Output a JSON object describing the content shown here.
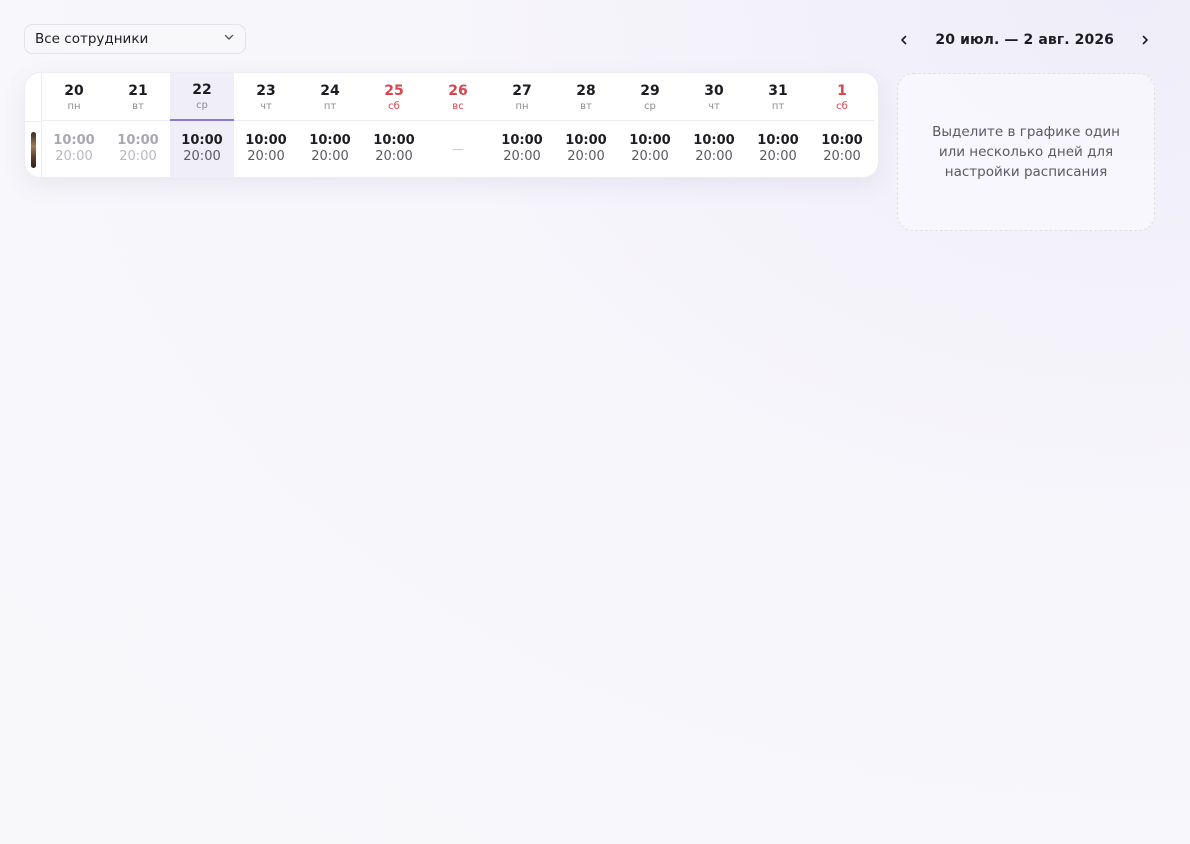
{
  "filter": {
    "label": "Все сотрудники"
  },
  "date_nav": {
    "range": "20 июл. — 2 авг. 2026"
  },
  "days": [
    {
      "num": "20",
      "wd": "пн",
      "start": "10:00",
      "end": "20:00",
      "state": "past"
    },
    {
      "num": "21",
      "wd": "вт",
      "start": "10:00",
      "end": "20:00",
      "state": "past"
    },
    {
      "num": "22",
      "wd": "ср",
      "start": "10:00",
      "end": "20:00",
      "state": "today"
    },
    {
      "num": "23",
      "wd": "чт",
      "start": "10:00",
      "end": "20:00",
      "state": "normal"
    },
    {
      "num": "24",
      "wd": "пт",
      "start": "10:00",
      "end": "20:00",
      "state": "normal"
    },
    {
      "num": "25",
      "wd": "сб",
      "start": "10:00",
      "end": "20:00",
      "state": "weekend"
    },
    {
      "num": "26",
      "wd": "вс",
      "start": "",
      "end": "",
      "off": "—",
      "state": "weekend"
    },
    {
      "num": "27",
      "wd": "пн",
      "start": "10:00",
      "end": "20:00",
      "state": "normal"
    },
    {
      "num": "28",
      "wd": "вт",
      "start": "10:00",
      "end": "20:00",
      "state": "normal"
    },
    {
      "num": "29",
      "wd": "ср",
      "start": "10:00",
      "end": "20:00",
      "state": "normal"
    },
    {
      "num": "30",
      "wd": "чт",
      "start": "10:00",
      "end": "20:00",
      "state": "normal"
    },
    {
      "num": "31",
      "wd": "пт",
      "start": "10:00",
      "end": "20:00",
      "state": "normal"
    },
    {
      "num": "1",
      "wd": "сб",
      "start": "10:00",
      "end": "20:00",
      "state": "weekend"
    }
  ],
  "hint": {
    "text": "Выделите в графике один или несколько дней для настройки расписания"
  },
  "colors": {
    "accent": "#8a7ad6",
    "weekend": "#d9434f",
    "today_bg": "#f0eef8"
  }
}
